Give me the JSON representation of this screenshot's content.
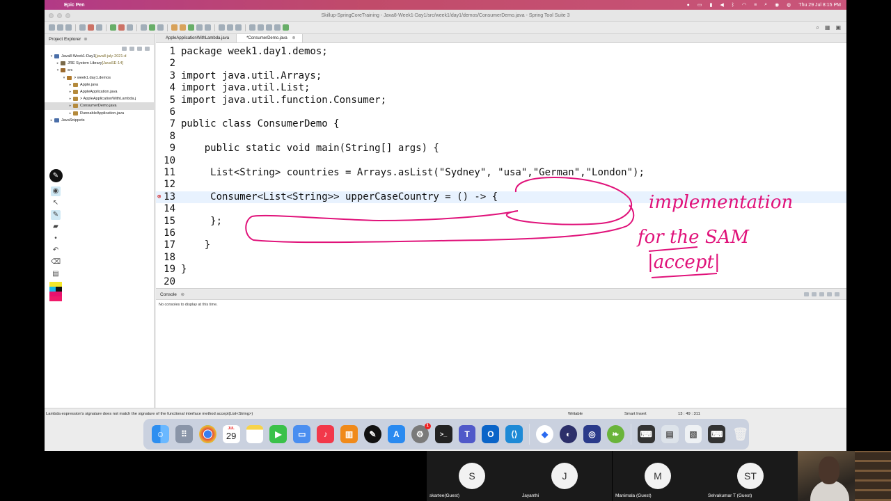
{
  "menubar": {
    "app_name": "Epic Pen",
    "date_time": "Thu 29 Jul  8:15 PM"
  },
  "window": {
    "title": "Skillup-SpringCoreTraining - Java8-Week1-Day1/src/week1/day1/demos/ConsumerDemo.java - Spring Tool Suite 3"
  },
  "explorer": {
    "title": "Project Explorer",
    "close": "⊗",
    "tree": [
      {
        "label": "Java8-Week1-Day1",
        "extra": " [java8-july-2021-d",
        "indent": 0,
        "arrow": "▾",
        "icon": "proj"
      },
      {
        "label": "JRE System Library",
        "extra": " [JavaSE-14]",
        "indent": 1,
        "arrow": "▸",
        "icon": "lib"
      },
      {
        "label": "src",
        "extra": "",
        "indent": 1,
        "arrow": "▾",
        "icon": "src"
      },
      {
        "label": "> week1.day1.demos",
        "extra": "",
        "indent": 2,
        "arrow": "▾",
        "icon": "pkg"
      },
      {
        "label": "Apple.java",
        "extra": "",
        "indent": 3,
        "arrow": "▸",
        "icon": "j"
      },
      {
        "label": "AppleApplication.java",
        "extra": "",
        "indent": 3,
        "arrow": "▸",
        "icon": "j"
      },
      {
        "label": "> AppleApplicationWithLambda.j",
        "extra": "",
        "indent": 3,
        "arrow": "▸",
        "icon": "j"
      },
      {
        "label": "ConsumerDemo.java",
        "extra": "",
        "indent": 3,
        "arrow": "▸",
        "icon": "j",
        "selected": true
      },
      {
        "label": "RunnableApplication.java",
        "extra": "",
        "indent": 3,
        "arrow": "▸",
        "icon": "j"
      },
      {
        "label": "JavaSnippets",
        "extra": "",
        "indent": 0,
        "arrow": "▸",
        "icon": "proj"
      }
    ]
  },
  "editor": {
    "tabs": [
      {
        "label": "AppleApplicationWithLambda.java",
        "active": false
      },
      {
        "label": "*ConsumerDemo.java",
        "active": true,
        "close": "⊗"
      }
    ],
    "lines": [
      {
        "n": "1",
        "text": "package week1.day1.demos;"
      },
      {
        "n": "2",
        "text": ""
      },
      {
        "n": "3",
        "text": "import java.util.Arrays;"
      },
      {
        "n": "4",
        "text": "import java.util.List;"
      },
      {
        "n": "5",
        "text": "import java.util.function.Consumer;"
      },
      {
        "n": "6",
        "text": ""
      },
      {
        "n": "7",
        "text": "public class ConsumerDemo {"
      },
      {
        "n": "8",
        "text": ""
      },
      {
        "n": "9",
        "text": "    public static void main(String[] args) {"
      },
      {
        "n": "10",
        "text": ""
      },
      {
        "n": "11",
        "text": "     List<String> countries = Arrays.asList(\"Sydney\", \"usa\",\"German\",\"London\");"
      },
      {
        "n": "12",
        "text": ""
      },
      {
        "n": "13",
        "text": "     Consumer<List<String>> upperCaseCountry = () -> {"
      },
      {
        "n": "14",
        "text": ""
      },
      {
        "n": "15",
        "text": "     };"
      },
      {
        "n": "16",
        "text": ""
      },
      {
        "n": "17",
        "text": "    }"
      },
      {
        "n": "18",
        "text": ""
      },
      {
        "n": "19",
        "text": "}"
      },
      {
        "n": "20",
        "text": ""
      }
    ],
    "annotation": {
      "line1": "implementation",
      "line2": "for the SAM",
      "line3": "|accept|"
    }
  },
  "console": {
    "title": "Console",
    "close": "⊗",
    "message": "No consoles to display at this time."
  },
  "status": {
    "message": "Lambda expression's signature does not match the signature of the functional interface method accept(List<String>)",
    "writable": "Writable",
    "insert_mode": "Smart Insert",
    "position": "13 : 49 : 311"
  },
  "dock": {
    "calendar_month": "JUL",
    "calendar_day": "29",
    "badge": "1",
    "apps": [
      "finder",
      "launchpad",
      "chrome",
      "calendar",
      "notes",
      "facetime",
      "keynote",
      "music",
      "books",
      "epic-pen",
      "app-store",
      "system-preferences",
      "terminal",
      "teams",
      "outlook",
      "vscode",
      "zoom",
      "eclipse",
      "stylus",
      "spring",
      "keyboard",
      "screenshot",
      "image",
      "keyboard2",
      "trash"
    ]
  },
  "participants": [
    {
      "initial": "S",
      "name": "skartee(Guest)"
    },
    {
      "initial": "J",
      "name": "Jayanthi"
    },
    {
      "initial": "M",
      "name": "Manimala (Guest)"
    },
    {
      "initial": "ST",
      "name": "Selvakumar T (Guest)"
    }
  ]
}
